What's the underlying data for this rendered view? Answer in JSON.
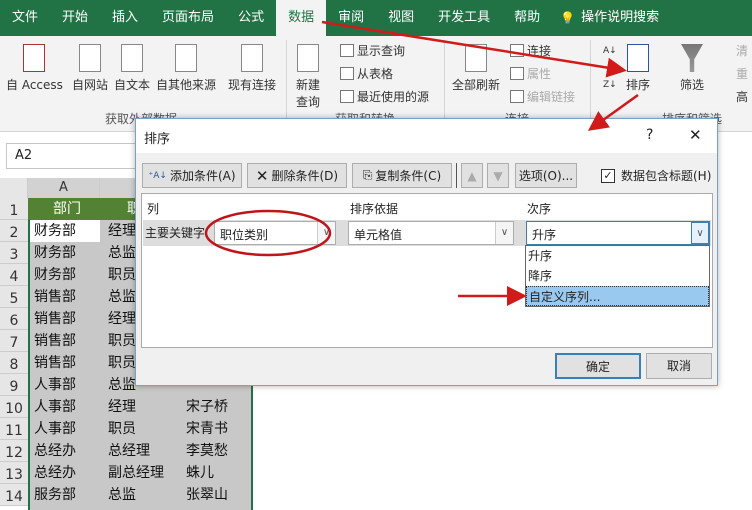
{
  "tabs": [
    "文件",
    "开始",
    "插入",
    "页面布局",
    "公式",
    "数据",
    "审阅",
    "视图",
    "开发工具",
    "帮助",
    "操作说明搜索"
  ],
  "active_tab": "数据",
  "ribbon": {
    "get_external": {
      "items": [
        "自 Access",
        "自网站",
        "自文本",
        "自其他来源",
        "现有连接"
      ],
      "label": "获取外部数据"
    },
    "get_transform": {
      "new_query": [
        "新建",
        "查询"
      ],
      "items": [
        "显示查询",
        "从表格",
        "最近使用的源"
      ],
      "label": "获取和转换"
    },
    "connections": {
      "refresh_all": "全部刷新",
      "items": [
        "连接",
        "属性",
        "编辑链接"
      ],
      "label": "连接"
    },
    "sort_filter": {
      "sort": "排序",
      "filter": "筛选",
      "truncated": [
        "清",
        "重",
        "高"
      ],
      "label": "排序和筛选"
    }
  },
  "name_box": "A2",
  "sheet": {
    "columns": [
      "A"
    ],
    "row_numbers": [
      "1",
      "2",
      "3",
      "4",
      "5",
      "6",
      "7",
      "8",
      "9",
      "10",
      "11",
      "12",
      "13",
      "14"
    ],
    "header": [
      "部门",
      "职位"
    ],
    "rows": [
      [
        "财务部",
        "经理",
        ""
      ],
      [
        "财务部",
        "总监",
        ""
      ],
      [
        "财务部",
        "职员",
        ""
      ],
      [
        "销售部",
        "总监",
        ""
      ],
      [
        "销售部",
        "经理",
        ""
      ],
      [
        "销售部",
        "职员",
        ""
      ],
      [
        "销售部",
        "职员",
        ""
      ],
      [
        "人事部",
        "总监",
        ""
      ],
      [
        "人事部",
        "经理",
        "宋子桥"
      ],
      [
        "人事部",
        "职员",
        "宋青书"
      ],
      [
        "总经办",
        "总经理",
        "李莫愁"
      ],
      [
        "总经办",
        "副总经理",
        "蛛儿"
      ],
      [
        "服务部",
        "总监",
        "张翠山"
      ]
    ]
  },
  "dialog": {
    "title": "排序",
    "help": "?",
    "close": "✕",
    "add": "添加条件(A)",
    "delete": "删除条件(D)",
    "copy": "复制条件(C)",
    "options": "选项(O)...",
    "has_header": "数据包含标题(H)",
    "has_header_checked": true,
    "col_header": "列",
    "sorton_header": "排序依据",
    "order_header": "次序",
    "key_label": "主要关键字",
    "key_value": "职位类别",
    "sorton_value": "单元格值",
    "order_value": "升序",
    "order_options": [
      "升序",
      "降序",
      "自定义序列..."
    ],
    "order_selected": "自定义序列...",
    "ok": "确定",
    "cancel": "取消"
  },
  "colors": {
    "excel_green": "#217346",
    "annotation_red": "#d11a1a",
    "selection": "#99c9ef"
  }
}
